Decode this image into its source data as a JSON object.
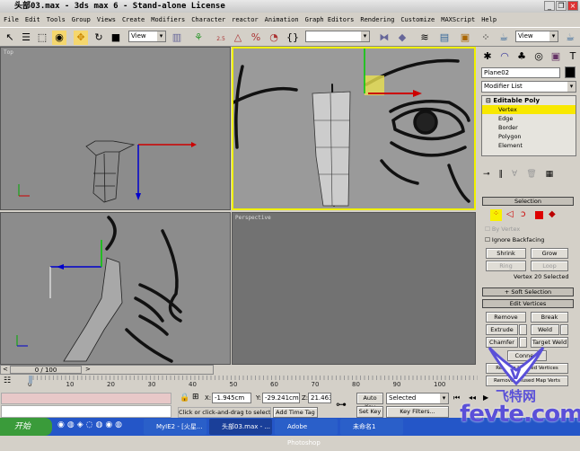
{
  "window": {
    "title": "头部03.max - 3ds max 6 - Stand-alone License"
  },
  "menu": [
    "File",
    "Edit",
    "Tools",
    "Group",
    "Views",
    "Create",
    "Modifiers",
    "Character",
    "reactor",
    "Animation",
    "Graph Editors",
    "Rendering",
    "Customize",
    "MAXScript",
    "Help"
  ],
  "toolbar": {
    "ref_coord": "View",
    "selection_set": "",
    "ref_coord2": "View",
    "snap_label": "2.5"
  },
  "viewports": {
    "top_label": "Top",
    "perspective_label": "Perspective"
  },
  "command_panel": {
    "object_name": "Plane02",
    "object_color": "#000000",
    "modifier_list": "Modifier List",
    "stack": {
      "root": "Editable Poly",
      "items": [
        "Vertex",
        "Edge",
        "Border",
        "Polygon",
        "Element"
      ],
      "selected": "Vertex"
    },
    "selection": {
      "title": "Selection",
      "by_vertex": "By Vertex",
      "ignore_backfacing": "Ignore Backfacing",
      "shrink": "Shrink",
      "grow": "Grow",
      "ring": "Ring",
      "loop": "Loop",
      "status": "Vertex 20 Selected"
    },
    "soft_selection": "Soft Selection",
    "edit_vertices": {
      "title": "Edit Vertices",
      "remove": "Remove",
      "break": "Break",
      "extrude": "Extrude",
      "weld": "Weld",
      "chamfer": "Chamfer",
      "target_weld": "Target Weld",
      "connect": "Connect",
      "remove_isolated": "Remove Isolated Vertices",
      "remove_unused": "Remove Unused Map Verts"
    }
  },
  "timeline": {
    "frame": "0 / 100",
    "ticks": [
      "0",
      "10",
      "20",
      "30",
      "40",
      "50",
      "60",
      "70",
      "80",
      "90",
      "100"
    ]
  },
  "status": {
    "x": "-1.945cm",
    "y": "-29.241cm",
    "z": "21.463cm",
    "prompt": "Click or click-and-drag to select ob",
    "add_time_tag": "Add Time Tag",
    "auto_key": "Auto Key",
    "set_key": "Set Key",
    "key_mode": "Selected",
    "key_filters": "Key Filters..."
  },
  "taskbar": {
    "start": "开始",
    "tasks": [
      "MyIE2 - [火星...",
      "头部03.max - ...",
      "Adobe Photoshop",
      "未命名1"
    ]
  },
  "watermark": {
    "text1": "飞特网",
    "text2": "fevte.com"
  },
  "colors": {
    "active_viewport": "#f0f000",
    "selection_highlight": "#f8e800",
    "viewport_bg": "#8c8c8c"
  }
}
